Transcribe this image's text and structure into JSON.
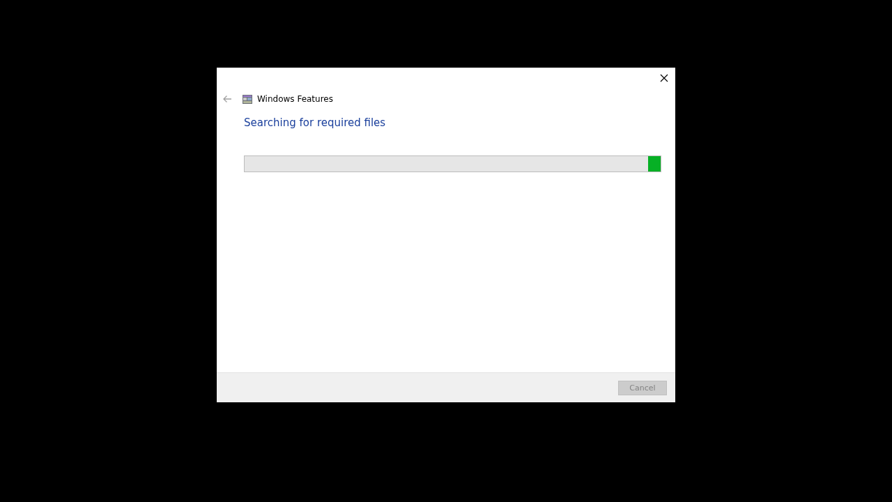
{
  "window": {
    "title": "Windows Features"
  },
  "back_button": {
    "disabled": true
  },
  "heading": "Searching for required files",
  "progress_bar": {
    "kind": "marquee"
  },
  "buttons": [
    {
      "label": "Cancel",
      "disabled": true
    }
  ]
}
